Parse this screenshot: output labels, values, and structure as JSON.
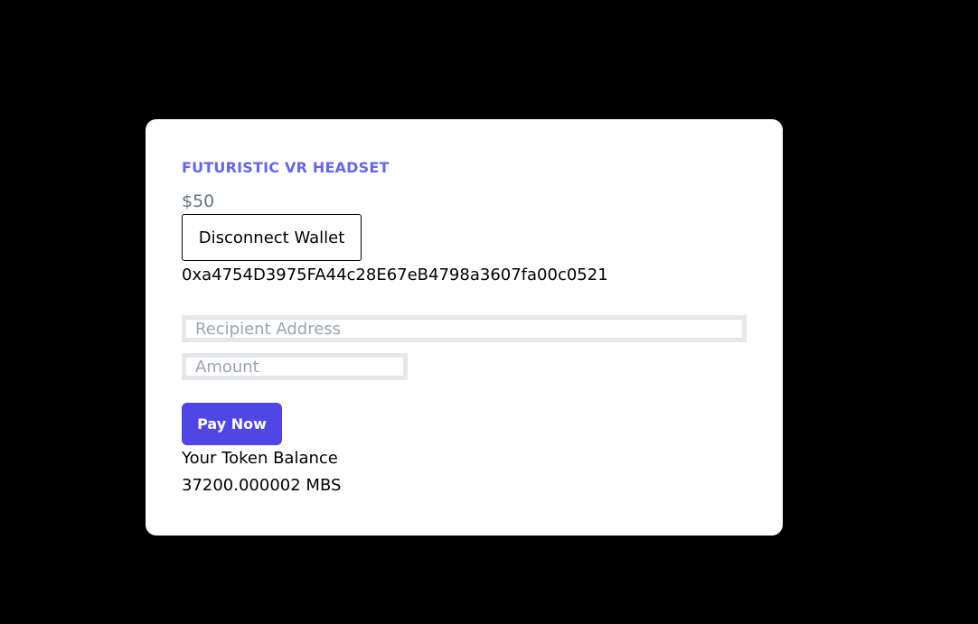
{
  "product": {
    "title": "FUTURISTIC VR HEADSET",
    "price": "$50"
  },
  "wallet": {
    "disconnect_label": "Disconnect Wallet",
    "address": "0xa4754D3975FA44c28E67eB4798a3607fa00c0521"
  },
  "form": {
    "recipient_placeholder": "Recipient Address",
    "recipient_value": "",
    "amount_placeholder": "Amount",
    "amount_value": "",
    "pay_label": "Pay Now"
  },
  "balance": {
    "label": "Your Token Balance",
    "value": "37200.000002 MBS"
  },
  "colors": {
    "background": "#000000",
    "card": "#ffffff",
    "accent": "#4f46e5",
    "title": "#6366f1",
    "price": "#6b7280",
    "field_border": "#e5e7eb"
  }
}
